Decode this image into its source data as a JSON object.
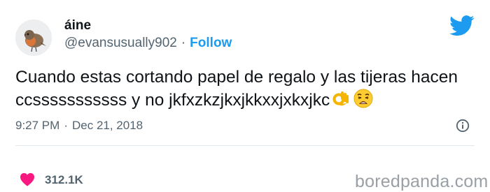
{
  "author": {
    "display_name": "áine",
    "handle": "@evansusually902",
    "separator": "·",
    "follow_label": "Follow"
  },
  "tweet": {
    "text": "Cuando estas cortando papel de regalo y las tijeras hacen ccsssssssssss y no jkfxzkzjkxjkkxxjxkxjkc",
    "emojis": [
      "ok-hand",
      "weary-face"
    ]
  },
  "meta": {
    "time": "9:27 PM",
    "separator": "·",
    "date": "Dec 21, 2018"
  },
  "engagement": {
    "likes": "312.1K"
  },
  "watermark": "boredpanda.com",
  "colors": {
    "accent": "#1d9bf0",
    "heart": "#f91880",
    "muted": "#536471",
    "text": "#0f1419"
  }
}
